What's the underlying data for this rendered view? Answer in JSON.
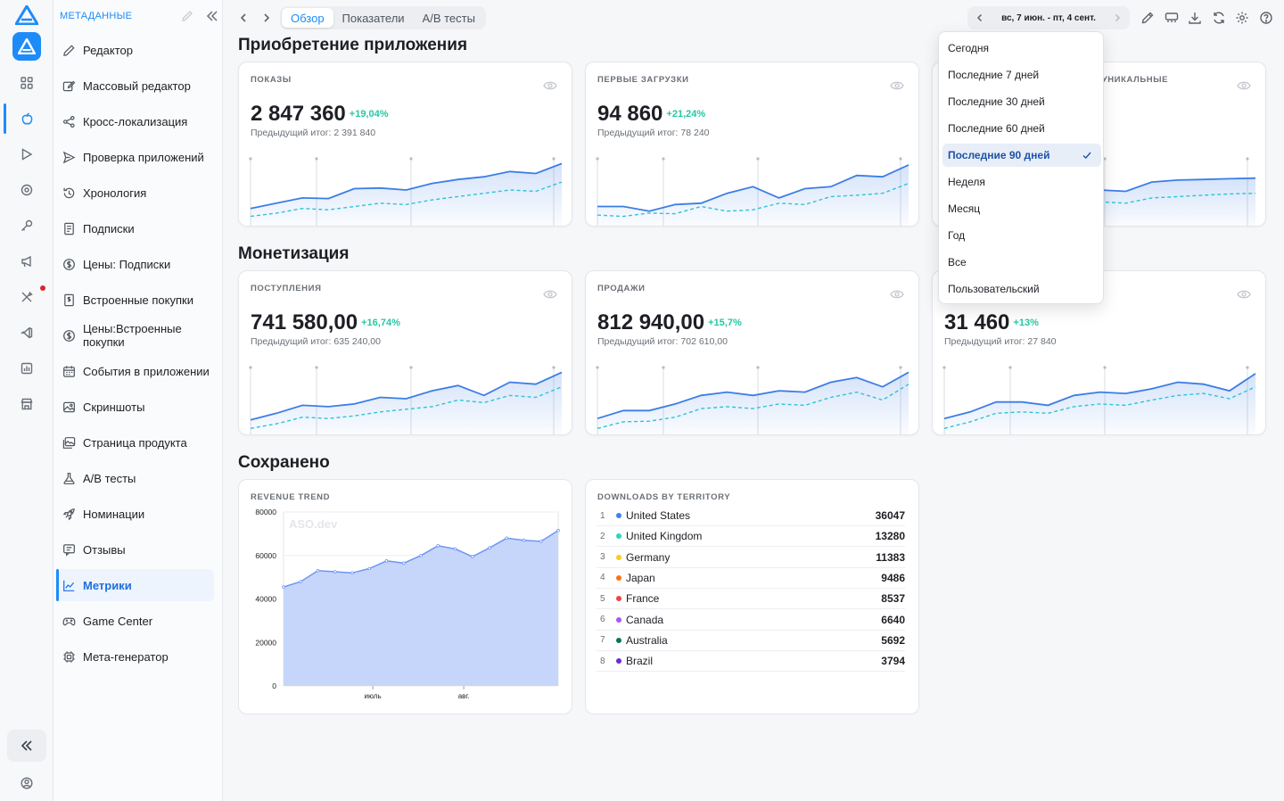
{
  "sidebar": {
    "title": "МЕТАДАННЫЕ",
    "items": [
      {
        "label": "Редактор",
        "icon": "pencil-icon"
      },
      {
        "label": "Массовый редактор",
        "icon": "bulk-edit-icon"
      },
      {
        "label": "Кросс-локализация",
        "icon": "share-icon"
      },
      {
        "label": "Проверка приложений",
        "icon": "send-icon"
      },
      {
        "label": "Хронология",
        "icon": "history-icon"
      },
      {
        "label": "Подписки",
        "icon": "receipt-icon"
      },
      {
        "label": "Цены: Подписки",
        "icon": "dollar-icon"
      },
      {
        "label": "Встроенные покупки",
        "icon": "purchase-icon"
      },
      {
        "label": "Цены:Встроенные покупки",
        "icon": "dollar-icon"
      },
      {
        "label": "События в приложении",
        "icon": "calendar-icon"
      },
      {
        "label": "Скриншоты",
        "icon": "image-icon"
      },
      {
        "label": "Страница продукта",
        "icon": "gallery-icon"
      },
      {
        "label": "A/B тесты",
        "icon": "flask-icon"
      },
      {
        "label": "Номинации",
        "icon": "rocket-icon"
      },
      {
        "label": "Отзывы",
        "icon": "review-icon"
      },
      {
        "label": "Метрики",
        "icon": "chart-icon",
        "active": true
      },
      {
        "label": "Game Center",
        "icon": "gamepad-icon"
      },
      {
        "label": "Мета-генератор",
        "icon": "chip-icon"
      }
    ]
  },
  "topbar": {
    "tabs": [
      {
        "label": "Обзор",
        "active": true
      },
      {
        "label": "Показатели"
      },
      {
        "label": "A/B тесты"
      }
    ],
    "date_range": "вс, 7 июн. - пт, 4 сент."
  },
  "sections": {
    "acquisition": "Приобретение приложения",
    "monetization": "Монетизация",
    "saved": "Сохранено"
  },
  "cards": {
    "impressions": {
      "label": "ПОКАЗЫ",
      "value": "2 847 360",
      "delta": "+19,04%",
      "prev": "Предыдущий итог: 2 391 840"
    },
    "first_downloads": {
      "label": "ПЕРВЫЕ ЗАГРУЗКИ",
      "value": "94 860",
      "delta": "+21,24%",
      "prev": "Предыдущий итог: 78 240"
    },
    "unique": {
      "label": "А УНИКАЛЬНЫЕ"
    },
    "proceeds": {
      "label": "ПОСТУПЛЕНИЯ",
      "value": "741 580,00",
      "delta": "+16,74%",
      "prev": "Предыдущий итог: 635 240,00"
    },
    "sales": {
      "label": "ПРОДАЖИ",
      "value": "812 940,00",
      "delta": "+15,7%",
      "prev": "Предыдущий итог: 702 610,00"
    },
    "third": {
      "value": "31 460",
      "delta": "+13%",
      "prev": "Предыдущий итог: 27 840"
    }
  },
  "revenue_card": {
    "title": "REVENUE TREND",
    "watermark": "ASO.dev"
  },
  "territory_card": {
    "title": "DOWNLOADS BY TERRITORY",
    "rows": [
      {
        "rank": "1",
        "name": "United States",
        "value": "36047",
        "color": "#3b82f6"
      },
      {
        "rank": "2",
        "name": "United Kingdom",
        "value": "13280",
        "color": "#2dd4bf"
      },
      {
        "rank": "3",
        "name": "Germany",
        "value": "11383",
        "color": "#facc15"
      },
      {
        "rank": "4",
        "name": "Japan",
        "value": "9486",
        "color": "#f97316"
      },
      {
        "rank": "5",
        "name": "France",
        "value": "8537",
        "color": "#ef4444"
      },
      {
        "rank": "6",
        "name": "Canada",
        "value": "6640",
        "color": "#a855f7"
      },
      {
        "rank": "7",
        "name": "Australia",
        "value": "5692",
        "color": "#047857"
      },
      {
        "rank": "8",
        "name": "Brazil",
        "value": "3794",
        "color": "#6d28d9"
      }
    ]
  },
  "dropdown": {
    "options": [
      "Сегодня",
      "Последние 7 дней",
      "Последние 30 дней",
      "Последние 60 дней",
      "Последние 90 дней",
      "Неделя",
      "Месяц",
      "Год",
      "Все",
      "Пользовательский"
    ],
    "selected": "Последние 90 дней"
  },
  "chart_data": {
    "type": "area",
    "title": "REVENUE TREND",
    "x_ticks": [
      "июль",
      "авг."
    ],
    "ylim": [
      0,
      80000
    ],
    "y_ticks": [
      0,
      20000,
      40000,
      60000,
      80000
    ],
    "values": [
      45500,
      48000,
      53000,
      52500,
      52000,
      54000,
      57500,
      56500,
      60000,
      64500,
      63000,
      59500,
      63500,
      68000,
      67000,
      66500,
      71500
    ],
    "grid": true,
    "colors": {
      "fill": "#c6d6fb",
      "line": "#6f97f0"
    }
  },
  "colors": {
    "accent": "#1d8cf8",
    "positive": "#27c7a2",
    "spark_current": "#3c7de6",
    "spark_previous": "#2ec4d6"
  }
}
